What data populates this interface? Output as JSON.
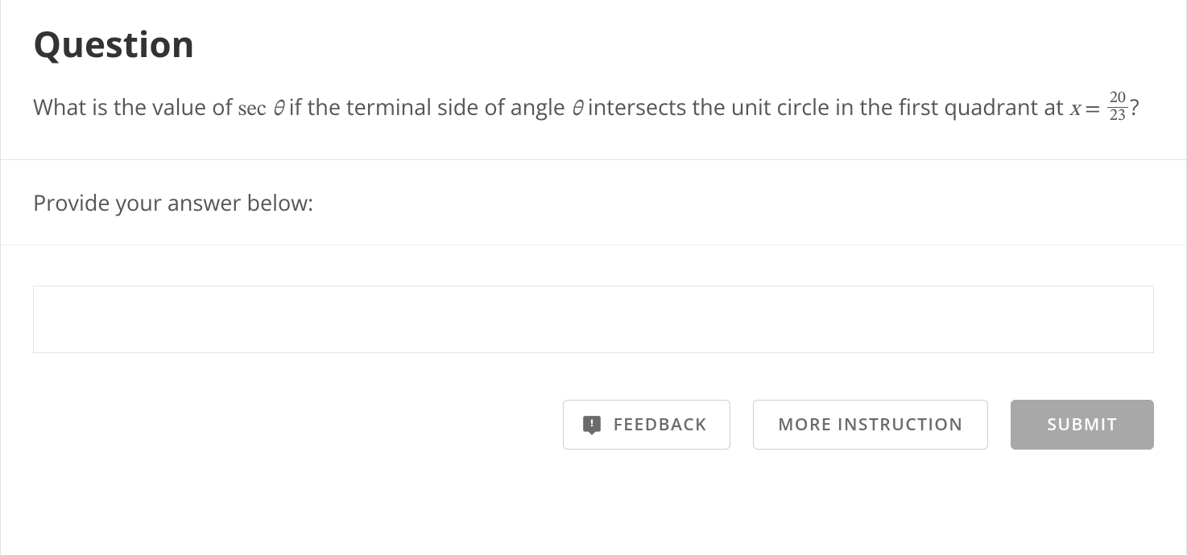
{
  "question": {
    "heading": "Question",
    "text_before_sec": "What is the value of ",
    "sec_label": "sec",
    "theta1": "θ",
    "text_mid1": " if the terminal side of angle ",
    "theta2": "θ",
    "text_mid2": " intersects the unit circle in the first quadrant at ",
    "var_x": "x",
    "equals": " = ",
    "frac_num": "20",
    "frac_den": "23",
    "qmark": "?"
  },
  "prompt": "Provide your answer below:",
  "answer_value": "",
  "buttons": {
    "feedback": "FEEDBACK",
    "more_instruction": "MORE INSTRUCTION",
    "submit": "SUBMIT"
  }
}
